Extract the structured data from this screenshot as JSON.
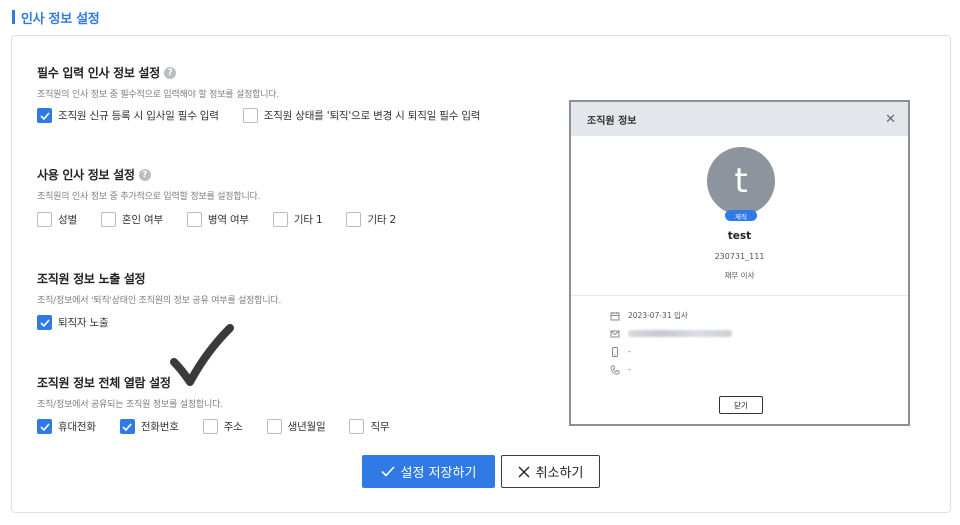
{
  "page": {
    "title": "인사 정보 설정"
  },
  "sections": [
    {
      "title": "필수 입력 인사 정보 설정",
      "has_help": true,
      "description": "조직원의 인사 정보 중 필수적으로 입력해야 할 정보를 설정합니다.",
      "options": [
        {
          "label": "조직원 신규 등록 시 입사일 필수 입력",
          "checked": true
        },
        {
          "label": "조직원 상태를 '퇴직'으로 변경 시 퇴직일 필수 입력",
          "checked": false
        }
      ]
    },
    {
      "title": "사용 인사 정보 설정",
      "has_help": true,
      "description": "조직원의 인사 정보 중 추가적으로 입력할 정보를 설정합니다.",
      "options": [
        {
          "label": "성별",
          "checked": false
        },
        {
          "label": "혼인 여부",
          "checked": false
        },
        {
          "label": "병역 여부",
          "checked": false
        },
        {
          "label": "기타 1",
          "checked": false
        },
        {
          "label": "기타 2",
          "checked": false
        }
      ]
    },
    {
      "title": "조직원 정보 노출 설정",
      "has_help": false,
      "description": "조직/정보에서 '퇴직'상태인 조직원의 정보 공유 여부를 설정합니다.",
      "options": [
        {
          "label": "퇴직자 노출",
          "checked": true
        }
      ]
    },
    {
      "title": "조직원 정보 전체 열람 설정",
      "has_help": false,
      "description": "조직/정보에서 공유되는 조직원 정보를 설정합니다.",
      "options": [
        {
          "label": "휴대전화",
          "checked": true
        },
        {
          "label": "전화번호",
          "checked": true
        },
        {
          "label": "주소",
          "checked": false
        },
        {
          "label": "생년월일",
          "checked": false
        },
        {
          "label": "직무",
          "checked": false
        }
      ]
    }
  ],
  "modal": {
    "title": "조직원 정보",
    "close_icon": "close-icon",
    "avatar_letter": "t",
    "status_badge": "재직",
    "name": "test",
    "employee_id": "230731_111",
    "role": "재무 이사",
    "hire_date": "2023-07-31 입사",
    "mobile": "-",
    "phone": "-",
    "close_button": "닫기"
  },
  "buttons": {
    "save": "설정 저장하기",
    "cancel": "취소하기"
  },
  "colors": {
    "accent": "#2f7ae5",
    "avatar": "#8e949d",
    "modal_header": "#e3e6ea"
  }
}
